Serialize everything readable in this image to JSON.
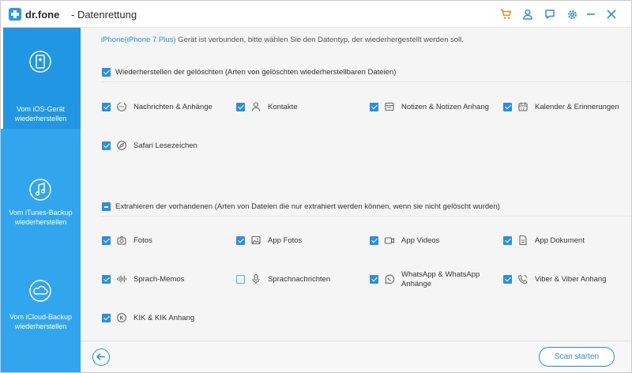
{
  "titlebar": {
    "brand": "dr.fone",
    "module": "- Datenrettung",
    "icons": [
      "cart-icon",
      "user-icon",
      "feedback-icon",
      "settings-icon",
      "minimize-icon",
      "close-icon"
    ],
    "colors": {
      "cart": "#f08a24",
      "other": "#2b8fe0"
    }
  },
  "sidebar": {
    "items": [
      {
        "label": "Vom iOS-Gerät wiederherstellen",
        "icon": "phone-restore-icon",
        "active": true
      },
      {
        "label": "Vom iTunes-Backup wiederherstellen",
        "icon": "music-restore-icon",
        "active": false
      },
      {
        "label": "Vom iCloud-Backup wiederherstellen",
        "icon": "cloud-restore-icon",
        "active": false
      }
    ]
  },
  "main": {
    "device_name": "iPhone(iPhone 7 Plus)",
    "device_text": " Gerät ist verbunden, bitte wählen Sie den Datentyp, der wiederhergestellt werden soll.",
    "deleted_section": {
      "title": "Wiederherstellen der gelöschten (Arten von gelöschten wiederherstellbaren Dateien)",
      "state": "checked",
      "options": [
        {
          "label": "Nachrichten & Anhänge",
          "icon": "message-icon",
          "checked": true
        },
        {
          "label": "Kontakte",
          "icon": "contact-icon",
          "checked": true
        },
        {
          "label": "Notizen & Notizen Anhang",
          "icon": "notes-icon",
          "checked": true
        },
        {
          "label": "Kalender & Erinnerungen",
          "icon": "calendar-icon",
          "checked": true
        },
        {
          "label": "Safari Lesezeichen",
          "icon": "safari-icon",
          "checked": true
        }
      ]
    },
    "existing_section": {
      "title": "Extrahieren der vorhandenen (Arten von Dateien die nur extrahiert werden können, wenn sie nicht gelöscht wurden)",
      "state": "partial",
      "options": [
        {
          "label": "Fotos",
          "icon": "camera-icon",
          "checked": true
        },
        {
          "label": "App Fotos",
          "icon": "image-icon",
          "checked": true
        },
        {
          "label": "App Videos",
          "icon": "video-icon",
          "checked": true
        },
        {
          "label": "App Dokument",
          "icon": "document-icon",
          "checked": true
        },
        {
          "label": "Sprach-Memos",
          "icon": "waveform-icon",
          "checked": true
        },
        {
          "label": "Sprachnachrichten",
          "icon": "microphone-icon",
          "checked": false
        },
        {
          "label": "WhatsApp & WhatsApp Anhänge",
          "icon": "whatsapp-icon",
          "checked": true
        },
        {
          "label": "Viber & Viber Anhang",
          "icon": "viber-icon",
          "checked": true
        },
        {
          "label": "KIK & KIK Anhang",
          "icon": "kik-icon",
          "checked": true
        }
      ]
    }
  },
  "footer": {
    "back_icon": "arrow-left-icon",
    "scan_label": "Scan starten"
  },
  "colors": {
    "accent": "#2b90d9",
    "sidebar": "#31a6ef",
    "sidebar_active": "#2196e3"
  }
}
